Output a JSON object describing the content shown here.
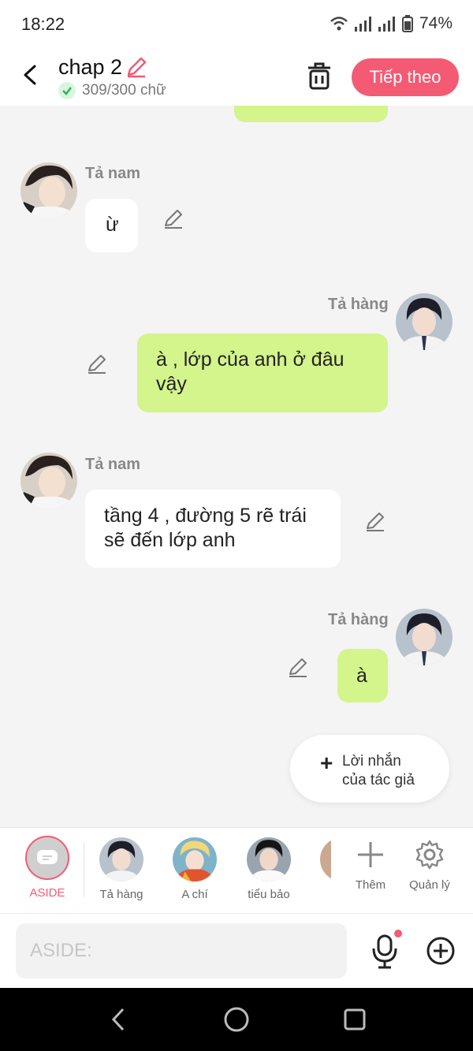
{
  "status": {
    "time": "18:22",
    "battery": "74%"
  },
  "header": {
    "title": "chap 2",
    "word_count": "309/300 chữ",
    "next_label": "Tiếp theo"
  },
  "messages": [
    {
      "side": "left",
      "name": "Tả nam",
      "text": "ừ"
    },
    {
      "side": "right",
      "name": "Tả hàng",
      "text": "à , lớp của anh ở đâu vậy"
    },
    {
      "side": "left",
      "name": "Tả nam",
      "text": "tầng 4 , đường 5 rẽ trái sẽ đến lớp anh"
    },
    {
      "side": "right",
      "name": "Tả hàng",
      "text": "à"
    }
  ],
  "author_note": {
    "label": "Lời nhắn của tác giả"
  },
  "characters": [
    {
      "label": "ASIDE"
    },
    {
      "label": "Tả hàng"
    },
    {
      "label": "A chí"
    },
    {
      "label": "tiểu bảo"
    },
    {
      "label": "Thêm"
    },
    {
      "label": "Quản lý"
    }
  ],
  "composer": {
    "placeholder": "ASIDE:"
  },
  "colors": {
    "accent": "#f45a73",
    "bubble_right": "#d4f48c",
    "bubble_left": "#ffffff"
  }
}
